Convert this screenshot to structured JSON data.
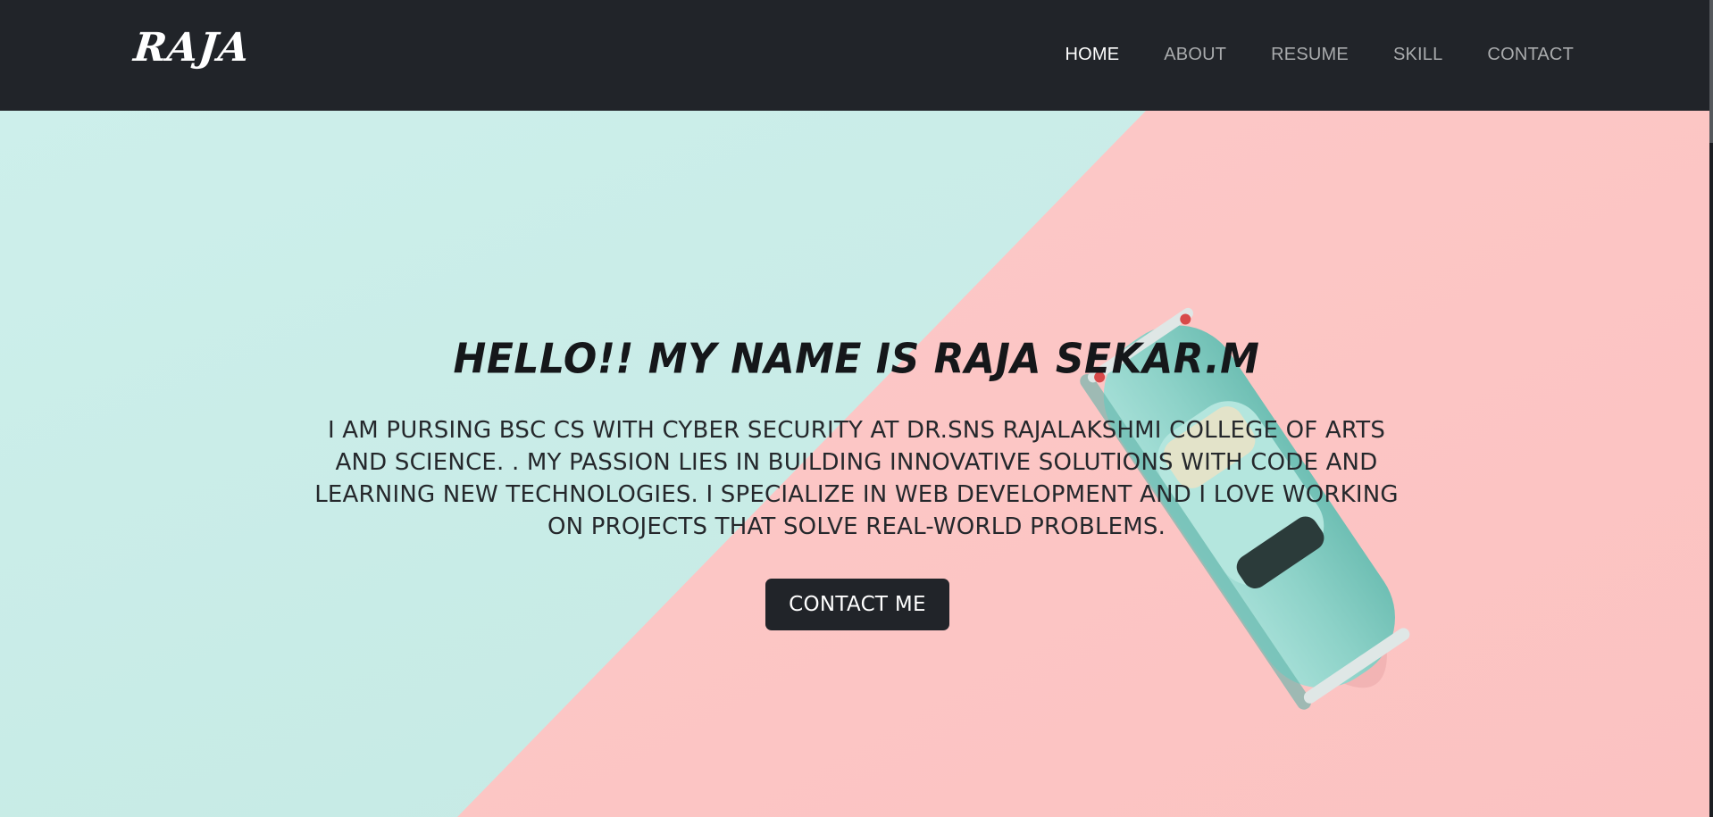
{
  "brand": "RAJA",
  "nav": {
    "items": [
      {
        "label": "HOME",
        "active": true
      },
      {
        "label": "ABOUT",
        "active": false
      },
      {
        "label": "RESUME",
        "active": false
      },
      {
        "label": "SKILL",
        "active": false
      },
      {
        "label": "CONTACT",
        "active": false
      }
    ]
  },
  "hero": {
    "title": "HELLO!! MY NAME IS RAJA SEKAR.M",
    "text": "I AM PURSING BSC CS WITH CYBER SECURITY AT DR.SNS RAJALAKSHMI COLLEGE OF ARTS AND SCIENCE. . MY PASSION LIES IN BUILDING INNOVATIVE SOLUTIONS WITH CODE AND LEARNING NEW TECHNOLOGIES. I SPECIALIZE IN WEB DEVELOPMENT AND I LOVE WORKING ON PROJECTS THAT SOLVE REAL-WORLD PROBLEMS.",
    "cta_label": "CONTACT ME"
  },
  "colors": {
    "navbar": "#212429",
    "mint": "#c9ece6",
    "pink": "#fcc5c4",
    "car": "#8fd3c9",
    "button": "#212429"
  }
}
